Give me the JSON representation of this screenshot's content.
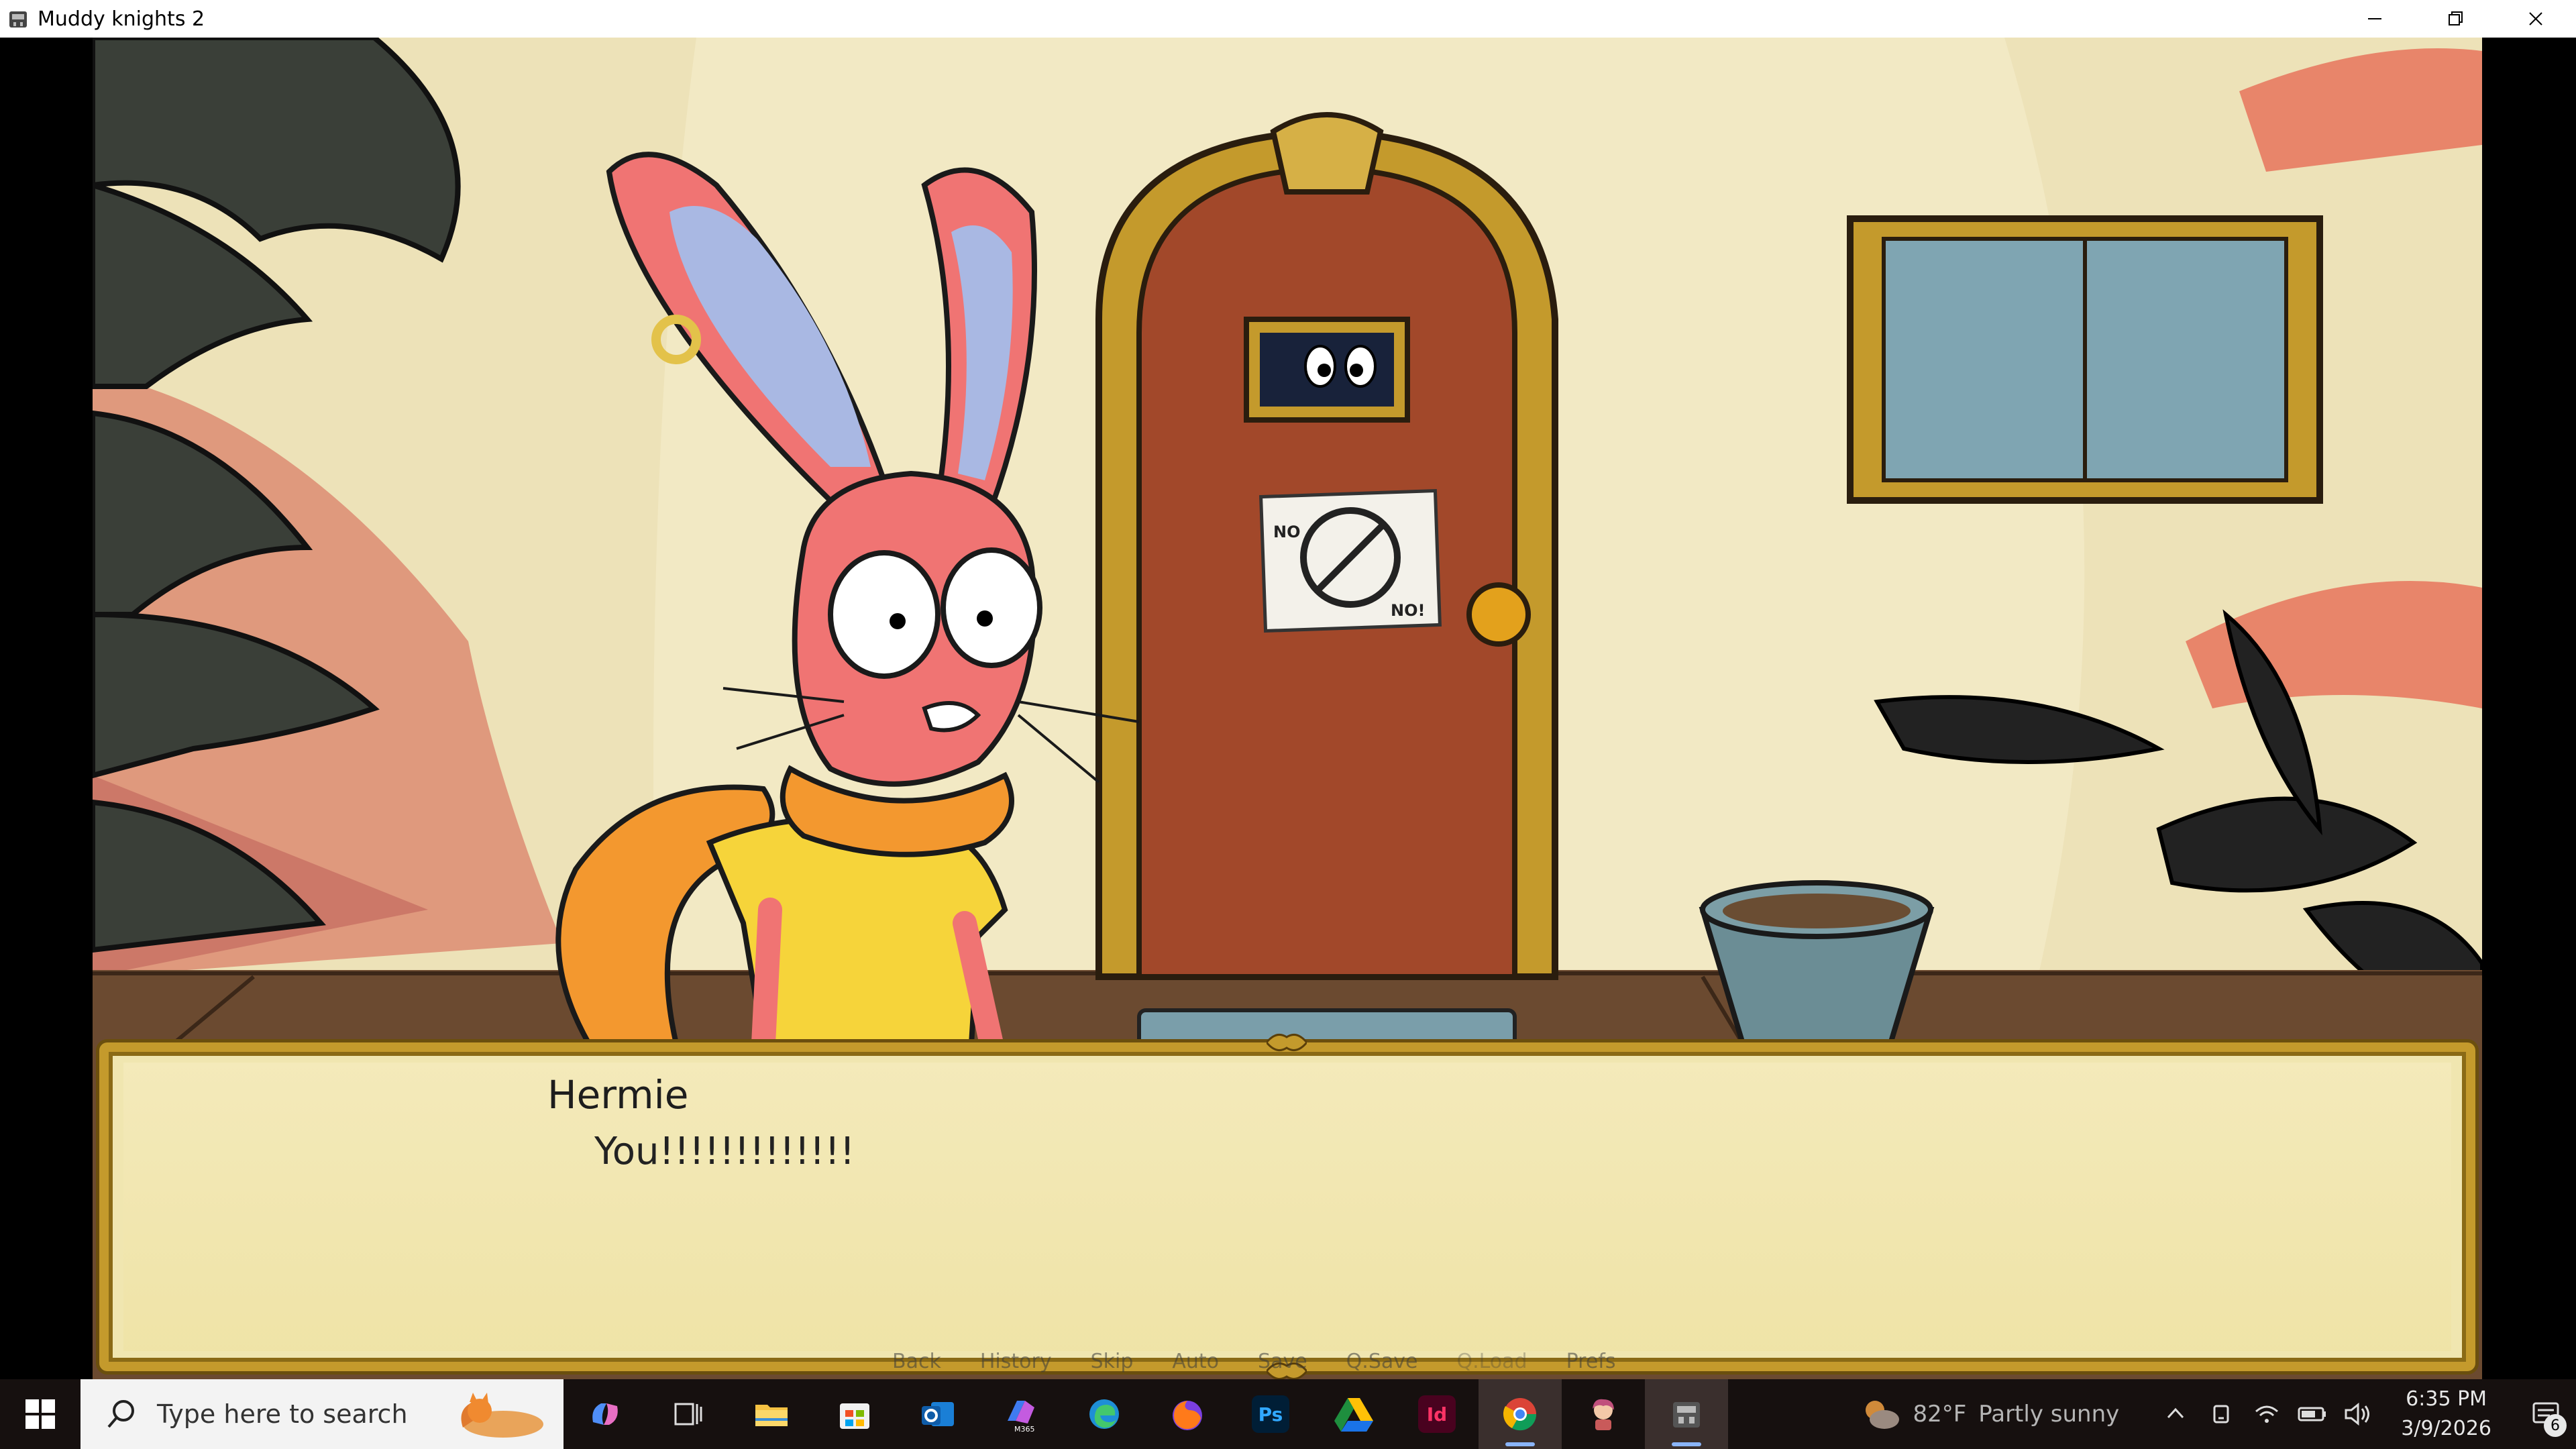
{
  "window": {
    "title": "Muddy knights 2"
  },
  "dialogue": {
    "speaker": "Hermie",
    "text": "You!!!!!!!!!!!!!"
  },
  "quick_menu": [
    "Back",
    "History",
    "Skip",
    "Auto",
    "Save",
    "Q.Save",
    "Q.Load",
    "Prefs"
  ],
  "door_sign": {
    "top_left": "NO",
    "bottom_right": "NO!"
  },
  "taskbar": {
    "search_placeholder": "Type here to search",
    "apps": [
      {
        "icon": "copilot-icon"
      },
      {
        "icon": "task-view-icon"
      },
      {
        "icon": "file-explorer-icon"
      },
      {
        "icon": "microsoft-store-icon"
      },
      {
        "icon": "outlook-icon"
      },
      {
        "icon": "m365-icon",
        "label": "M365"
      },
      {
        "icon": "edge-icon"
      },
      {
        "icon": "firefox-icon"
      },
      {
        "icon": "photoshop-icon",
        "label": "Ps"
      },
      {
        "icon": "google-drive-icon"
      },
      {
        "icon": "indesign-icon",
        "label": "Id"
      },
      {
        "icon": "chrome-icon"
      },
      {
        "icon": "game-character-icon"
      },
      {
        "icon": "muddy-knights-icon"
      }
    ],
    "weather": {
      "temp": "82°F",
      "condition": "Partly sunny"
    },
    "clock": {
      "time": "6:35 PM",
      "date": "3/9/2026"
    },
    "notification_count": "6"
  },
  "colors": {
    "wall": "#ede2b8",
    "door": "#a2482a",
    "door_frame": "#c49a2c",
    "bunny_pink": "#f07473",
    "shirt_yellow": "#f6d43a",
    "scarf_orange": "#f3982f",
    "dialogue_bg": "#f0e6b0",
    "taskbar_bg": "#16100f"
  }
}
